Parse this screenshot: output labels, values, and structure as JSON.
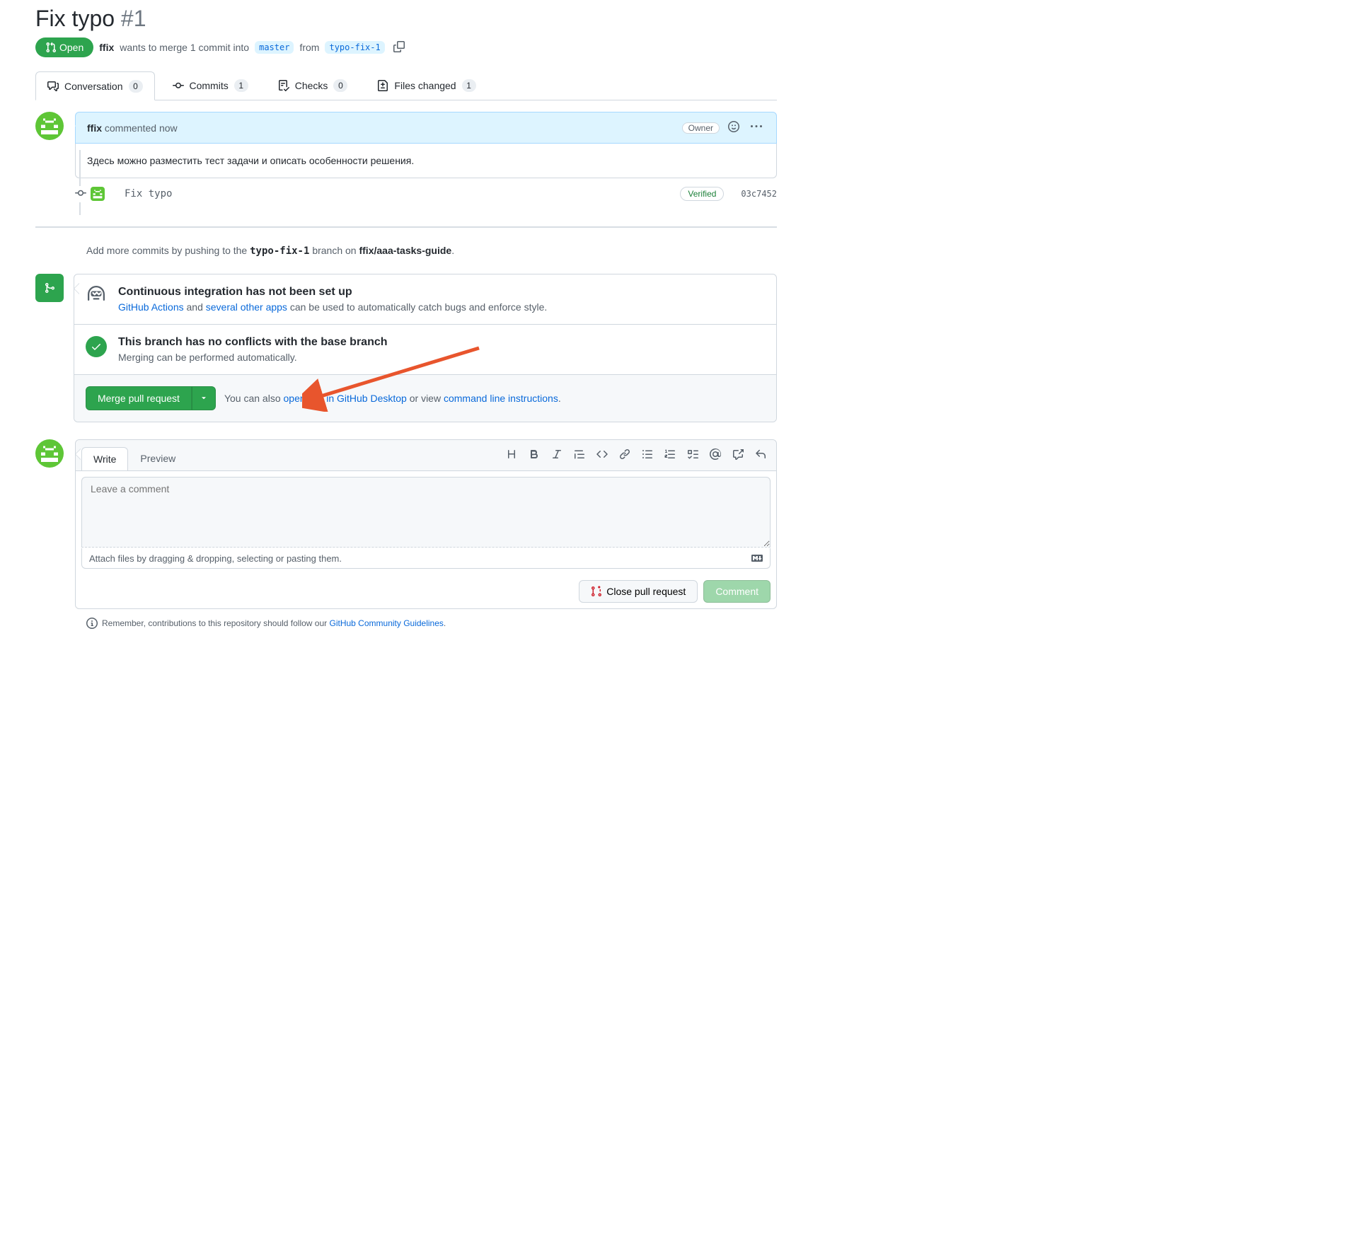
{
  "pr": {
    "title": "Fix typo",
    "number": "#1",
    "state": "Open",
    "author": "ffix",
    "merge_text_1": "wants to merge 1 commit into",
    "base_branch": "master",
    "from_text": "from",
    "head_branch": "typo-fix-1"
  },
  "tabs": {
    "conversation": {
      "label": "Conversation",
      "count": "0"
    },
    "commits": {
      "label": "Commits",
      "count": "1"
    },
    "checks": {
      "label": "Checks",
      "count": "0"
    },
    "files": {
      "label": "Files changed",
      "count": "1"
    }
  },
  "comment": {
    "author": "ffix",
    "action": "commented",
    "time": "now",
    "owner_label": "Owner",
    "body": "Здесь можно разместить тест задачи и описать особенности решения."
  },
  "commit": {
    "message": "Fix typo",
    "verified": "Verified",
    "sha": "03c7452"
  },
  "push_hint": {
    "prefix": "Add more commits by pushing to the",
    "branch": "typo-fix-1",
    "mid": "branch on",
    "repo": "ffix/aaa-tasks-guide",
    "suffix": "."
  },
  "ci": {
    "title": "Continuous integration has not been set up",
    "actions_link": "GitHub Actions",
    "and": "and",
    "apps_link": "several other apps",
    "rest": "can be used to automatically catch bugs and enforce style."
  },
  "no_conflicts": {
    "title": "This branch has no conflicts with the base branch",
    "subtitle": "Merging can be performed automatically."
  },
  "merge": {
    "button": "Merge pull request",
    "hint_prefix": "You can also",
    "desktop_link": "open this in GitHub Desktop",
    "or_view": "or view",
    "cli_link": "command line instructions",
    "dot": "."
  },
  "editor": {
    "write_tab": "Write",
    "preview_tab": "Preview",
    "placeholder": "Leave a comment",
    "attach_hint": "Attach files by dragging & dropping, selecting or pasting them.",
    "close_label": "Close pull request",
    "comment_label": "Comment"
  },
  "footer": {
    "prefix": "Remember, contributions to this repository should follow our",
    "link": "GitHub Community Guidelines",
    "suffix": "."
  }
}
